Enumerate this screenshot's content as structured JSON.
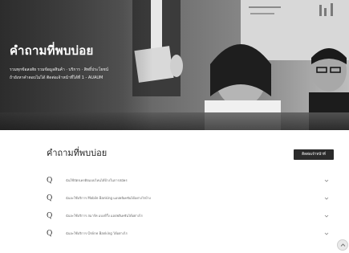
{
  "hero": {
    "title": "คำถามที่พบบ่อย",
    "subtitle_line1": "รวมทุกข้อสงสัย รวมข้อมูลสินค้า · บริการ · สิทธิ์ประโยชน์",
    "subtitle_line2": "ถ้ายังหาคำตอบไม่ได้ ติดต่อเจ้าหน้าที่ได้ที่ 1 - AUAUM",
    "image_icon": "office-people-photo"
  },
  "faq": {
    "heading": "คำถามที่พบบ่อย",
    "contact_button_label": "ติดต่อเจ้าหน้าที่",
    "q_marker": "Q",
    "items": [
      {
        "text": "ฉันใช้บัตรเครดิตแบบไหนได้บ้างในการสมัคร"
      },
      {
        "text": "ฉันจะใช้บริการ Mobile Banking แอปพลิเคชันได้อย่างไรบ้าง"
      },
      {
        "text": "ฉันจะใช้บริการ สมาร์ท แบงก์กิ้ง แอปพลิเคชันได้อย่างไร"
      },
      {
        "text": "ฉันจะใช้บริการ Online Banking ได้อย่างไร"
      }
    ],
    "chevron_icon": "chevron-down-icon"
  },
  "scroll_top": {
    "icon": "arrow-up-icon"
  },
  "colors": {
    "button_bg": "#2b2b2b",
    "heading_text": "#222222",
    "item_text": "#666666"
  }
}
